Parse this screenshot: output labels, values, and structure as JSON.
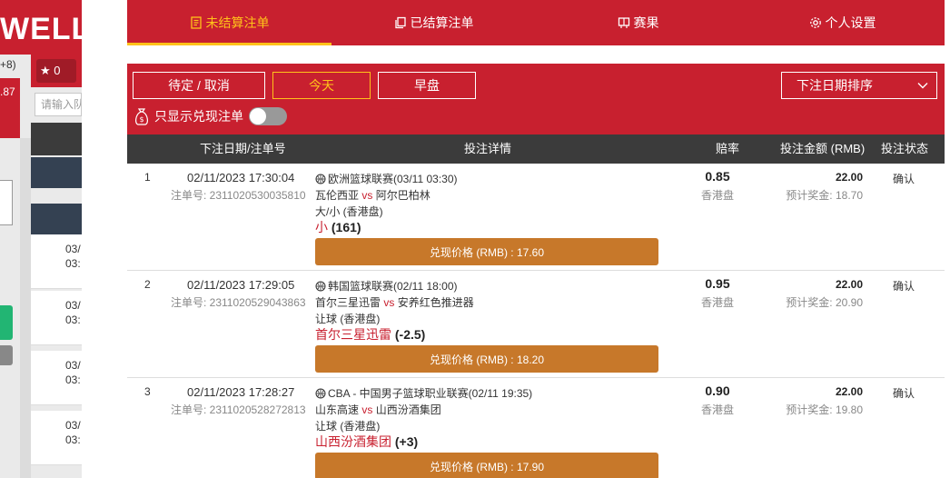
{
  "background": {
    "logo_text": "WELL",
    "odds_hint": "+8)",
    "red_strip_value": ".87",
    "fav_count": "0",
    "search_placeholder": "请输入队",
    "rows": [
      {
        "d": "03/",
        "t": "03:"
      },
      {
        "d": "03/",
        "t": "03:"
      },
      {
        "d": "03/",
        "t": "03:"
      },
      {
        "d": "03/",
        "t": "03:"
      }
    ]
  },
  "tabs": [
    {
      "label": "未结算注单",
      "icon": "document-list-icon",
      "active": true
    },
    {
      "label": "已结算注单",
      "icon": "settled-stack-icon",
      "active": false
    },
    {
      "label": "赛果",
      "icon": "scoreboard-icon",
      "active": false
    },
    {
      "label": "个人设置",
      "icon": "gear-icon",
      "active": false
    }
  ],
  "filters": {
    "pending_cancel": "待定 / 取消",
    "today": "今天",
    "early": "早盘",
    "sort": "下注日期排序",
    "cashout_only": "只显示兑现注单"
  },
  "columns": {
    "date_id": "下注日期/注单号",
    "details": "投注详情",
    "odds": "赔率",
    "stake": "投注金额 (RMB)",
    "status": "投注状态"
  },
  "bets": [
    {
      "index": "1",
      "datetime": "02/11/2023 17:30:04",
      "bet_id": "注单号: 2311020530035810",
      "league": "欧洲篮球联赛(03/11 03:30)",
      "home": "瓦伦西亚",
      "vs": "vs",
      "away": "阿尔巴柏林",
      "market": "大/小 (香港盘)",
      "selection": "小",
      "line": "(161)",
      "cashout": "兑现价格 (RMB) : 17.60",
      "odds": "0.85",
      "odds_type": "香港盘",
      "stake": "22.00",
      "payout": "预计奖金: 18.70",
      "status": "确认"
    },
    {
      "index": "2",
      "datetime": "02/11/2023 17:29:05",
      "bet_id": "注单号: 2311020529043863",
      "league": "韩国篮球联赛(02/11 18:00)",
      "home": "首尔三星迅雷",
      "vs": "vs",
      "away": "安养红色推进器",
      "market": "让球 (香港盘)",
      "selection": "首尔三星迅雷",
      "line": "(-2.5)",
      "cashout": "兑现价格 (RMB) : 18.20",
      "odds": "0.95",
      "odds_type": "香港盘",
      "stake": "22.00",
      "payout": "预计奖金: 20.90",
      "status": "确认"
    },
    {
      "index": "3",
      "datetime": "02/11/2023 17:28:27",
      "bet_id": "注单号: 2311020528272813",
      "league": "CBA - 中国男子篮球职业联赛(02/11 19:35)",
      "home": "山东高速",
      "vs": "vs",
      "away": "山西汾酒集团",
      "market": "让球 (香港盘)",
      "selection": "山西汾酒集团",
      "line": "(+3)",
      "cashout": "兑现价格 (RMB) : 17.90",
      "odds": "0.90",
      "odds_type": "香港盘",
      "stake": "22.00",
      "payout": "预计奖金: 19.80",
      "status": "确认"
    }
  ]
}
